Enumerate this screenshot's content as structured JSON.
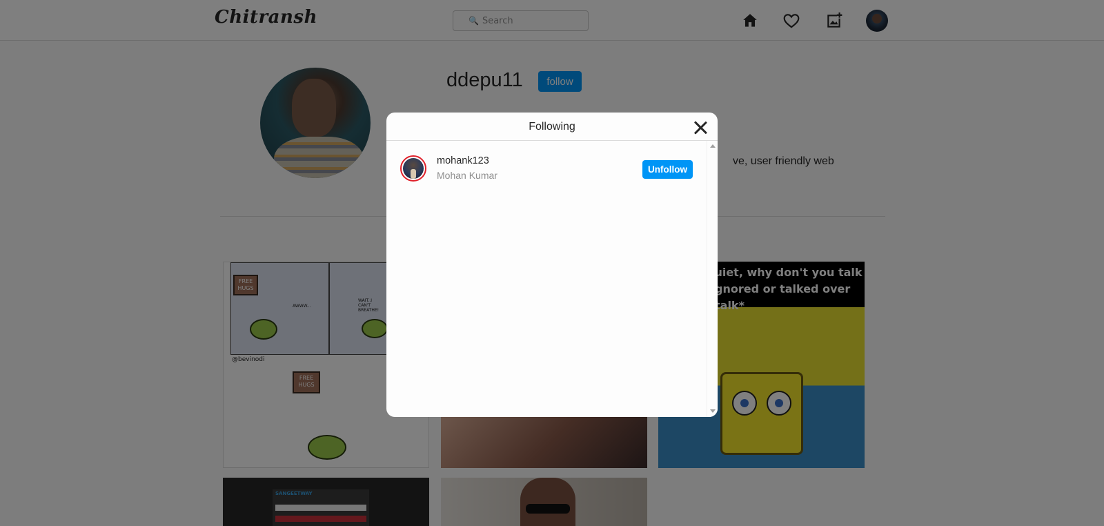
{
  "header": {
    "logo": "Chitransh",
    "search_placeholder": "Search",
    "icons": [
      "search-icon",
      "home-icon",
      "heart-icon",
      "add-post-icon",
      "profile-avatar"
    ]
  },
  "profile": {
    "username": "ddepu11",
    "follow_label": "follow",
    "bio_fragment": "ve, user friendly web"
  },
  "posts": {
    "post1_handle": "@bevinodi",
    "post1_sign_1": "FREE HUGS",
    "post1_sign_2": "FREE HUGS",
    "post1_text_1": "AWWW...",
    "post1_text_2": "WAIT..I CAN'T BREATHE!",
    "post3_lines": [
      "quiet, why don't you talk more?\"",
      "gnored or talked over",
      "talk*"
    ],
    "post4_brand": "SANGEETWAY"
  },
  "modal": {
    "title": "Following",
    "users": [
      {
        "username": "mohank123",
        "full_name": "Mohan Kumar",
        "action_label": "Unfollow"
      }
    ]
  },
  "colors": {
    "accent": "#0095f6",
    "avatar_ring": "#e0202a",
    "overlay": "rgba(0,0,0,0.5)"
  }
}
